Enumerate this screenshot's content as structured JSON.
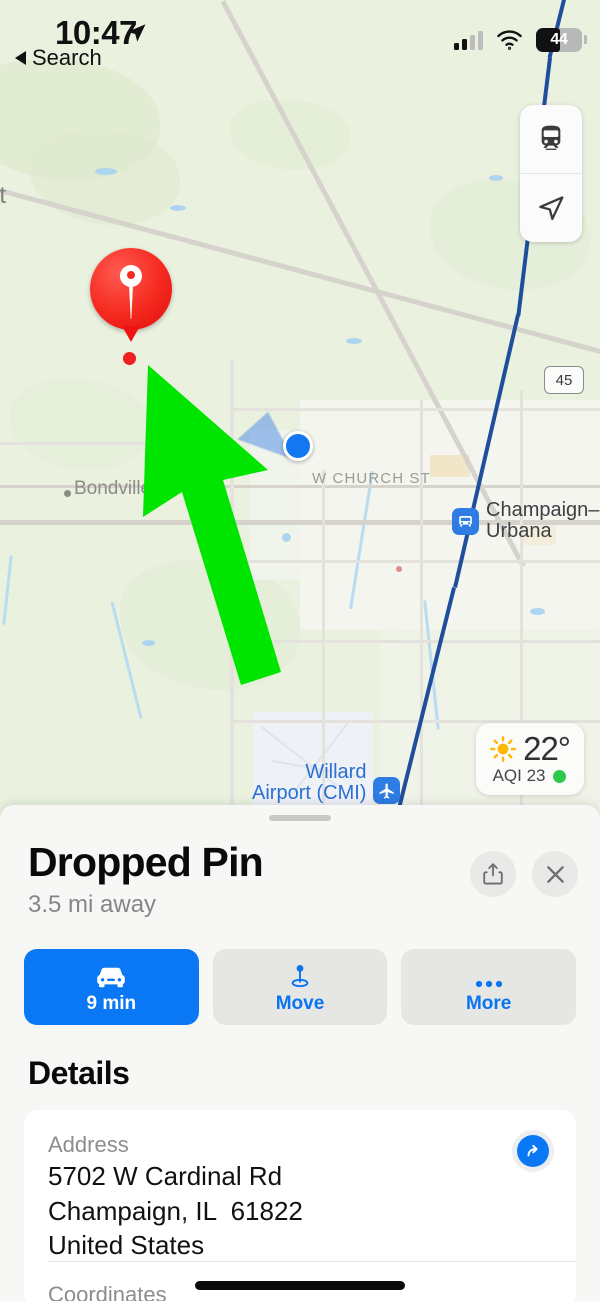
{
  "status_bar": {
    "time": "10:47",
    "location_arrow_icon": "location-arrow-icon",
    "back_label": "Search",
    "back_chevron_icon": "chevron-left-icon",
    "signal_icon": "cellular-signal-icon",
    "signal_bars_filled": 2,
    "signal_bars_total": 4,
    "wifi_icon": "wifi-icon",
    "battery_percent": "44",
    "battery_icon": "battery-icon"
  },
  "map": {
    "controls": [
      {
        "name": "transit-button",
        "icon": "train-icon"
      },
      {
        "name": "locate-me-button",
        "icon": "navigation-arrow-icon"
      }
    ],
    "dropped_pin_icon": "dropped-pin-icon",
    "user_location_icon": "user-location-dot",
    "annotation_arrow_icon": "green-arrow-annotation",
    "annotation_color": "#00e500",
    "labels": [
      {
        "text": "et",
        "type": "town-truncated"
      },
      {
        "text": "Bondville",
        "type": "town"
      },
      {
        "text": "W CHURCH ST",
        "type": "street"
      }
    ],
    "pois": [
      {
        "text": "Champaign–\nUrbana",
        "icon": "bus-station-icon",
        "style": "dark"
      },
      {
        "text": "Willard\nAirport (CMI)",
        "icon": "airport-icon",
        "style": "blue"
      }
    ],
    "highway_shield": "45",
    "weather": {
      "icon": "sun-icon",
      "temperature": "22°",
      "aqi_label": "AQI 23",
      "aqi_status_color": "#2ec84a"
    }
  },
  "sheet": {
    "grabber": "drag-handle",
    "title": "Dropped Pin",
    "distance": "3.5 mi away",
    "share_icon": "share-icon",
    "close_icon": "close-icon",
    "actions": [
      {
        "label": "9 min",
        "icon": "car-icon",
        "primary": true
      },
      {
        "label": "Move",
        "icon": "move-pin-icon",
        "primary": false
      },
      {
        "label": "More",
        "icon": "ellipsis-icon",
        "primary": false
      }
    ],
    "details_title": "Details",
    "address": {
      "label": "Address",
      "lines": [
        "5702 W Cardinal Rd",
        "Champaign, IL  61822",
        "United States"
      ],
      "line1": "5702 W Cardinal Rd",
      "line2": "Champaign, IL  61822",
      "line3": "United States",
      "directions_icon": "directions-arrow-icon"
    },
    "coordinates_label": "Coordinates"
  }
}
